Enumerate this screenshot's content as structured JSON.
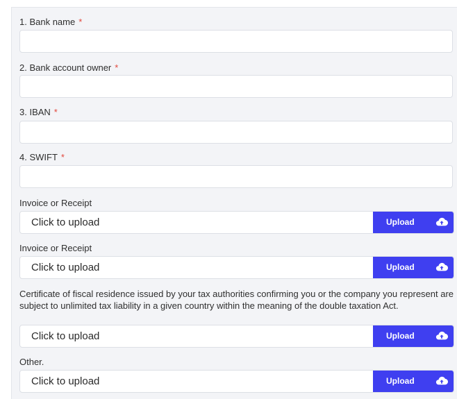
{
  "fields": [
    {
      "label": "1. Bank name",
      "required_mark": "*",
      "value": ""
    },
    {
      "label": "2. Bank account owner",
      "required_mark": "*",
      "value": ""
    },
    {
      "label": "3. IBAN",
      "required_mark": "*",
      "value": ""
    },
    {
      "label": "4. SWIFT",
      "required_mark": "*",
      "value": ""
    }
  ],
  "uploads": [
    {
      "label": "Invoice or Receipt",
      "placeholder": "Click to upload",
      "button_label": "Upload",
      "icon": "cloud-upload-icon"
    },
    {
      "label": "Invoice or Receipt",
      "placeholder": "Click to upload",
      "button_label": "Upload",
      "icon": "cloud-upload-icon"
    },
    {
      "label": "Certificate of fiscal residence issued by your tax authorities confirming you or the company you represent are subject to unlimited tax liability in a given country within the meaning of the double taxation Act.",
      "placeholder": "Click to upload",
      "button_label": "Upload",
      "icon": "cloud-upload-icon"
    },
    {
      "label": "Other.",
      "placeholder": "Click to upload",
      "button_label": "Upload",
      "icon": "cloud-upload-icon"
    }
  ],
  "colors": {
    "accent": "#3f3ff0",
    "required": "#e2483d",
    "panel_bg": "#f3f4f7"
  }
}
